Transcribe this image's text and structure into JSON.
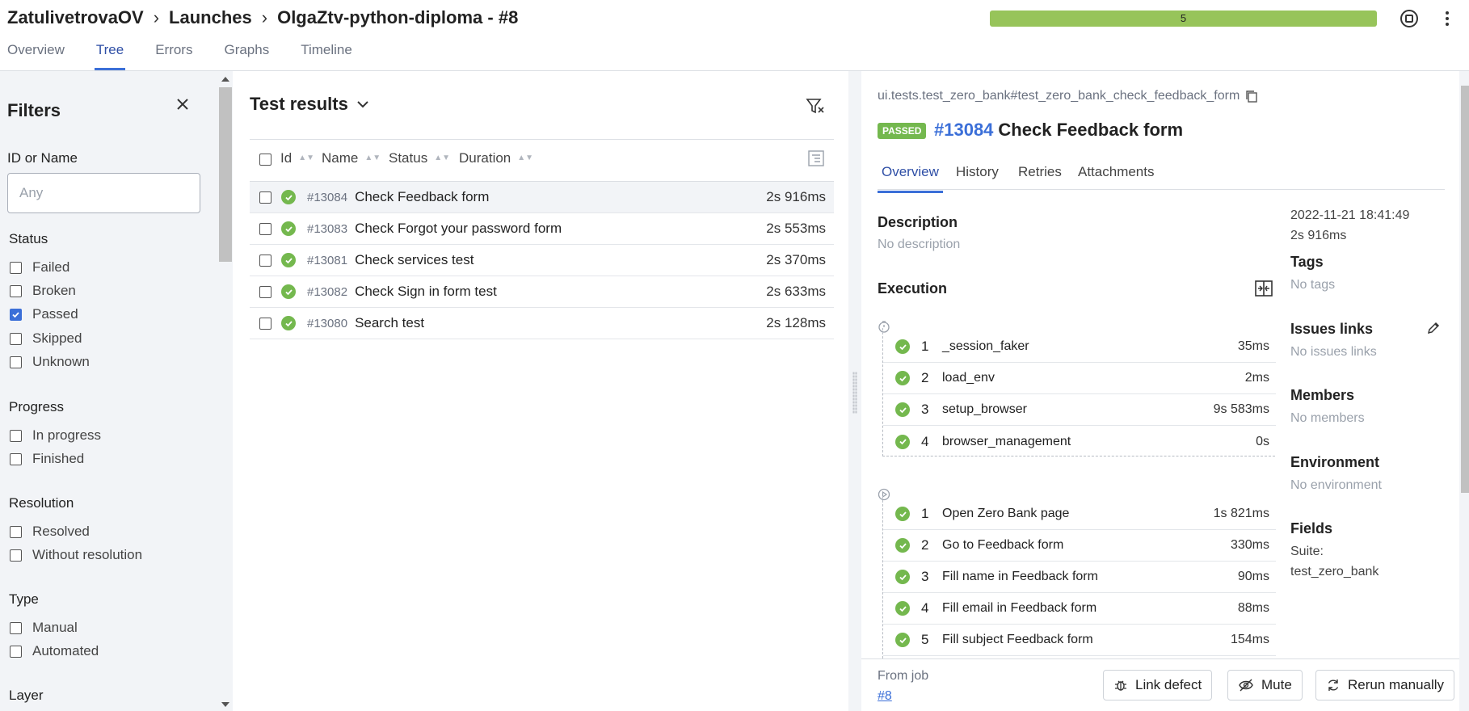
{
  "breadcrumbs": [
    "ZatulivetrovaOV",
    "Launches",
    "OlgaZtv-python-diploma - #8"
  ],
  "progress": {
    "label": "5",
    "fraction": 1.0,
    "color": "#97c45a"
  },
  "tabs": [
    "Overview",
    "Tree",
    "Errors",
    "Graphs",
    "Timeline"
  ],
  "active_tab": "Tree",
  "filters": {
    "title": "Filters",
    "id_label": "ID or Name",
    "id_placeholder": "Any",
    "status_label": "Status",
    "status": [
      {
        "label": "Failed",
        "checked": false
      },
      {
        "label": "Broken",
        "checked": false
      },
      {
        "label": "Passed",
        "checked": true
      },
      {
        "label": "Skipped",
        "checked": false
      },
      {
        "label": "Unknown",
        "checked": false
      }
    ],
    "progress_label": "Progress",
    "progress": [
      {
        "label": "In progress"
      },
      {
        "label": "Finished"
      }
    ],
    "resolution_label": "Resolution",
    "resolution": [
      {
        "label": "Resolved"
      },
      {
        "label": "Without resolution"
      }
    ],
    "type_label": "Type",
    "type": [
      {
        "label": "Manual"
      },
      {
        "label": "Automated"
      }
    ],
    "layer_label": "Layer"
  },
  "results": {
    "title": "Test results",
    "columns": [
      "Id",
      "Name",
      "Status",
      "Duration"
    ],
    "rows": [
      {
        "id": "#13084",
        "name": "Check Feedback form",
        "duration": "2s 916ms",
        "selected": true
      },
      {
        "id": "#13083",
        "name": "Check Forgot your password form",
        "duration": "2s 553ms"
      },
      {
        "id": "#13081",
        "name": "Check services test",
        "duration": "2s 370ms"
      },
      {
        "id": "#13082",
        "name": "Check Sign in form test",
        "duration": "2s 633ms"
      },
      {
        "id": "#13080",
        "name": "Search test",
        "duration": "2s 128ms"
      }
    ]
  },
  "detail": {
    "path": "ui.tests.test_zero_bank#test_zero_bank_check_feedback_form",
    "status_badge": "PASSED",
    "test_id": "#13084",
    "test_name": "Check Feedback form",
    "tabs": [
      "Overview",
      "History",
      "Retries",
      "Attachments"
    ],
    "description_label": "Description",
    "description": "No description",
    "execution_label": "Execution",
    "setup_steps": [
      {
        "num": "1",
        "name": "_session_faker",
        "duration": "35ms"
      },
      {
        "num": "2",
        "name": "load_env",
        "duration": "2ms"
      },
      {
        "num": "3",
        "name": "setup_browser",
        "duration": "9s 583ms"
      },
      {
        "num": "4",
        "name": "browser_management",
        "duration": "0s"
      }
    ],
    "body_steps": [
      {
        "num": "1",
        "name": "Open Zero Bank page",
        "duration": "1s 821ms"
      },
      {
        "num": "2",
        "name": "Go to Feedback form",
        "duration": "330ms"
      },
      {
        "num": "3",
        "name": "Fill name in Feedback form",
        "duration": "90ms"
      },
      {
        "num": "4",
        "name": "Fill email in Feedback form",
        "duration": "88ms"
      },
      {
        "num": "5",
        "name": "Fill subject Feedback form",
        "duration": "154ms"
      }
    ],
    "started": "2022-11-21 18:41:49",
    "duration": "2s 916ms",
    "tags_label": "Tags",
    "tags": "No tags",
    "issues_label": "Issues links",
    "issues": "No issues links",
    "members_label": "Members",
    "members": "No members",
    "environment_label": "Environment",
    "environment": "No environment",
    "fields_label": "Fields",
    "fields_key": "Suite:",
    "fields_value": "test_zero_bank",
    "from_job_label": "From job",
    "from_job_link": "#8",
    "buttons": {
      "link_defect": "Link defect",
      "mute": "Mute",
      "rerun": "Rerun manually"
    }
  }
}
